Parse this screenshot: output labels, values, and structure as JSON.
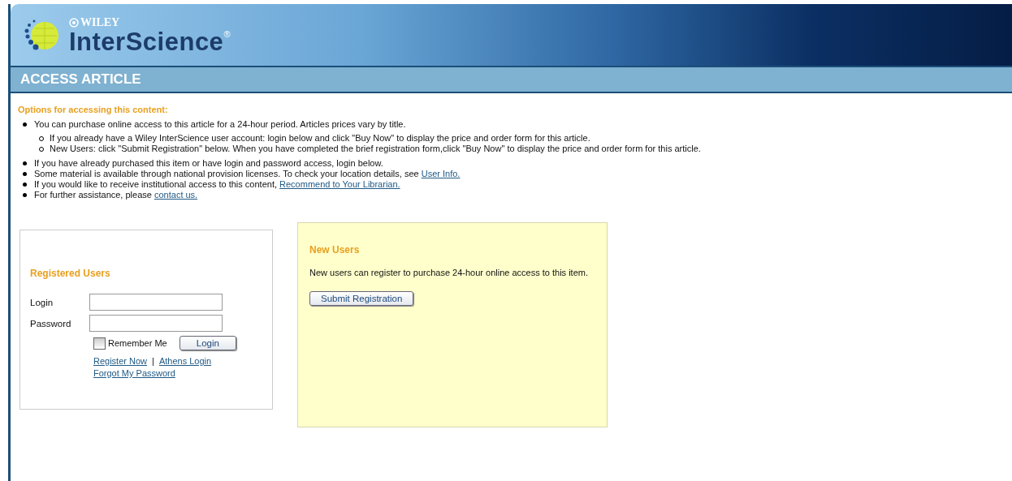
{
  "header": {
    "brand_top": "WILEY",
    "brand_name": "InterScience",
    "brand_mark": "®"
  },
  "section_bar": {
    "title": "ACCESS ARTICLE"
  },
  "options": {
    "heading": "Options for accessing this content:",
    "items": [
      {
        "text": "You can purchase online access to this article for a 24-hour period. Articles prices vary by title.",
        "children": [
          {
            "text": "If you already have a Wiley InterScience user account: login below and click \"Buy Now\" to display the price and order form for this article."
          },
          {
            "text": "New Users: click \"Submit Registration\" below. When you have completed the brief registration form,click \"Buy Now\" to display the price and order form for this article."
          }
        ]
      },
      {
        "text": "If you have already purchased this item or have login and password access, login below."
      },
      {
        "text": "Some material is available through national provision licenses. To check your location details, see ",
        "link": "User Info."
      },
      {
        "text": "If you would like to receive institutional access to this content, ",
        "link": "Recommend to Your Librarian."
      },
      {
        "text": "For further assistance, please ",
        "link": "contact us."
      }
    ]
  },
  "registered": {
    "heading": "Registered Users",
    "login_label": "Login",
    "password_label": "Password",
    "remember": {
      "label": "Remember Me",
      "checked": false
    },
    "login_button": "Login",
    "links": [
      "Register Now",
      "Athens Login"
    ],
    "separator": "|",
    "forgot": "Forgot My Password"
  },
  "new_users": {
    "heading": "New Users",
    "text": "New users can register to purchase 24-hour online access to this item.",
    "button": "Submit Registration"
  }
}
